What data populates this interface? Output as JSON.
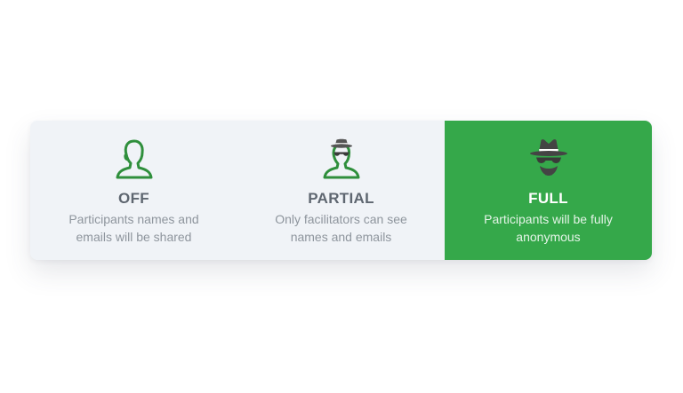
{
  "anonymity": {
    "options": [
      {
        "icon": "person-icon",
        "title": "OFF",
        "description": "Participants names and emails will be shared",
        "selected": false
      },
      {
        "icon": "person-hat-sunglasses-icon",
        "title": "PARTIAL",
        "description": "Only facilitators can see names and emails",
        "selected": false
      },
      {
        "icon": "spy-incognito-icon",
        "title": "FULL",
        "description": "Participants will be fully anonymous",
        "selected": true
      }
    ]
  },
  "colors": {
    "accent": "#35a84a",
    "panel_background": "#f0f3f7",
    "title_text": "#5e6670",
    "description_text": "#8e959d",
    "icon_green": "#2f8f3c",
    "icon_gray": "#444444"
  }
}
